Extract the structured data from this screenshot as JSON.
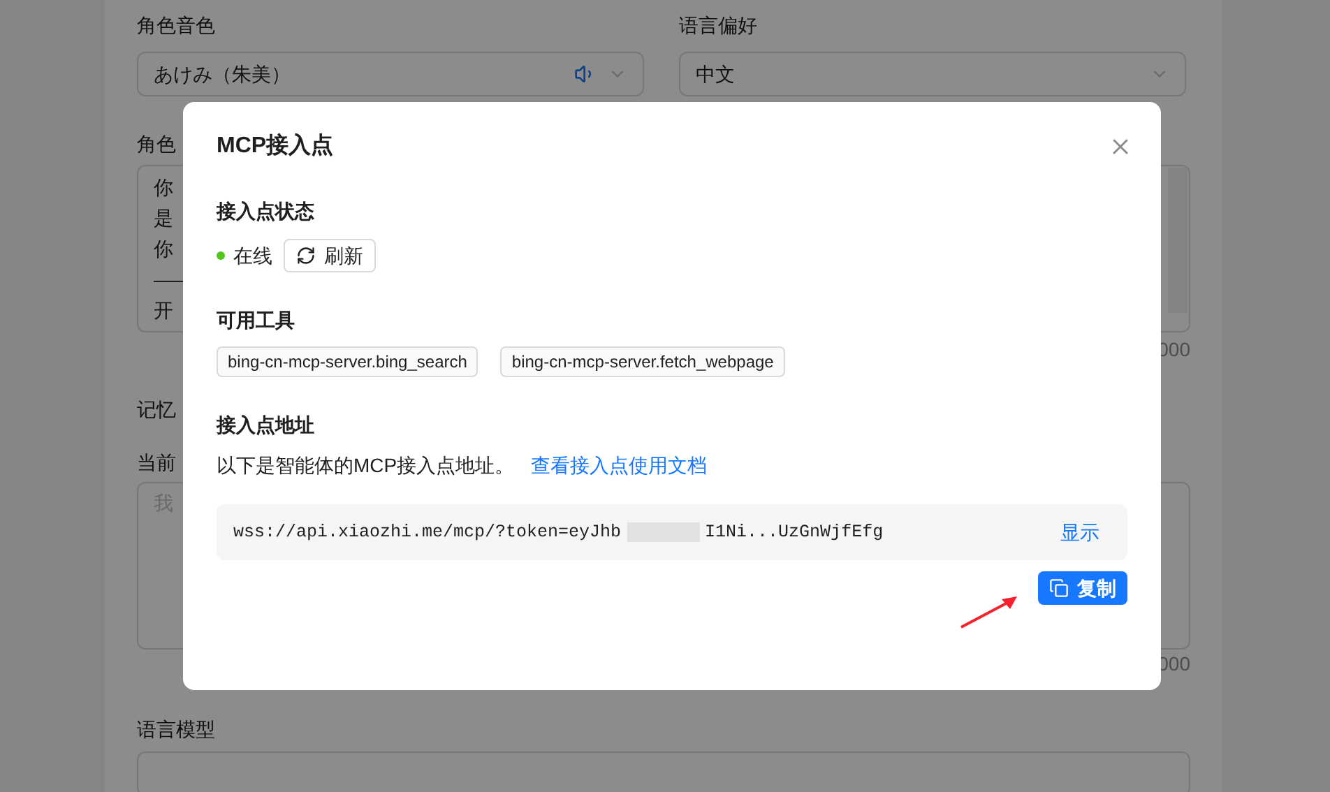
{
  "page": {
    "voice_label": "角色音色",
    "voice_value": "あけみ（朱美）",
    "language_label": "语言偏好",
    "language_value": "中文",
    "intro_label": "角色",
    "intro_lines": [
      "你",
      "是",
      "你",
      "——",
      "开"
    ],
    "intro_count": "000",
    "memory_label": "记忆",
    "current_label": "当前",
    "memory_placeholder": "我",
    "memory_count": "000",
    "model_label": "语言模型"
  },
  "dialog": {
    "title": "MCP接入点",
    "status_heading": "接入点状态",
    "status": {
      "label": "在线",
      "online": true
    },
    "refresh_button": "刷新",
    "tools_heading": "可用工具",
    "tools": [
      "bing-cn-mcp-server.bing_search",
      "bing-cn-mcp-server.fetch_webpage"
    ],
    "address_heading": "接入点地址",
    "address_description": "以下是智能体的MCP接入点地址。",
    "docs_link": "查看接入点使用文档",
    "token_start": "wss://api.xiaozhi.me/mcp/?token=eyJhb",
    "token_end": "I1Ni...UzGnWjfEfg",
    "show_button": "显示",
    "copy_button": "复制"
  }
}
